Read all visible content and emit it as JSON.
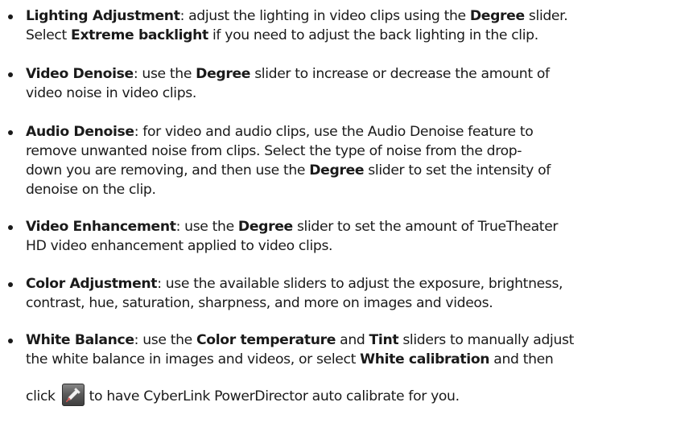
{
  "items": [
    {
      "lines": [
        [
          "Lighting Adjustment",
          ": adjust the lighting in video clips using the ",
          "Degree",
          " slider."
        ],
        [
          "Select ",
          "Extreme backlight",
          " if you need to adjust the back lighting in the clip."
        ]
      ]
    },
    {
      "lines": [
        [
          "Video Denoise",
          ": use the ",
          "Degree",
          " slider to increase or decrease the amount of"
        ],
        [
          "video noise in video clips."
        ]
      ]
    },
    {
      "lines": [
        [
          "Audio Denoise",
          ": for video and audio clips, use the Audio Denoise feature to"
        ],
        [
          "remove unwanted noise from clips. Select the type of noise from the drop-"
        ],
        [
          "down you are removing, and then use the ",
          "Degree",
          " slider to set the intensity of"
        ],
        [
          "denoise on the clip."
        ]
      ]
    },
    {
      "lines": [
        [
          "Video Enhancement",
          ": use the ",
          "Degree",
          " slider to set the amount of TrueTheater"
        ],
        [
          "HD video enhancement applied to video clips."
        ]
      ]
    },
    {
      "lines": [
        [
          "Color Adjustment",
          ": use the available sliders to adjust the exposure, brightness,"
        ],
        [
          "contrast, hue, saturation, sharpness, and more on images and videos."
        ]
      ]
    },
    {
      "lines": [
        [
          "White Balance",
          ": use the ",
          "Color temperature",
          " and ",
          "Tint",
          " sliders to manually adjust"
        ],
        [
          "the white balance in images and videos, or select ",
          "White calibration",
          " and then"
        ]
      ],
      "last_before": "click",
      "last_after": "to have CyberLink PowerDirector auto calibrate for you."
    }
  ],
  "icons": {
    "picker": "eyedropper-icon"
  }
}
